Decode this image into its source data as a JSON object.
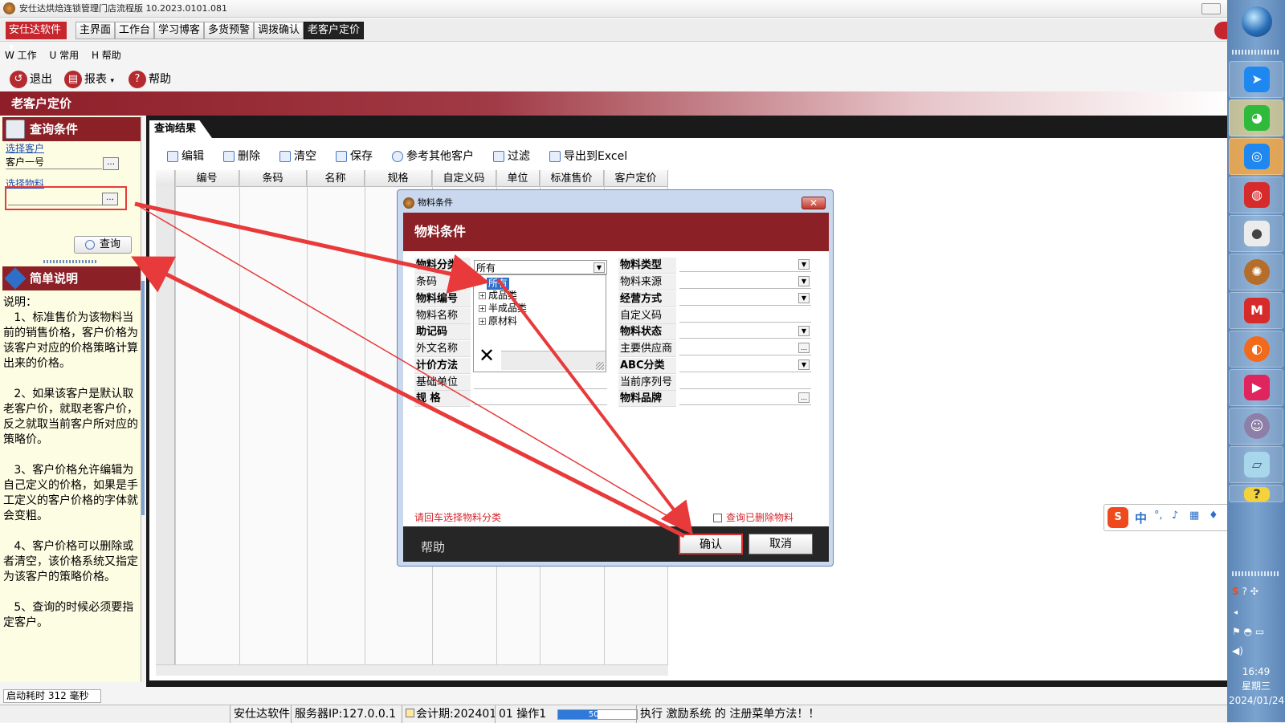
{
  "window": {
    "title": "安仕达烘焙连锁管理门店流程版  10.2023.0101.081"
  },
  "brand": {
    "label": "安仕达软件"
  },
  "main_tabs": [
    "主界面",
    "工作台",
    "学习博客",
    "多货预警",
    "调拨确认",
    "老客户定价"
  ],
  "menu": [
    "W 工作",
    "U 常用",
    "H 帮助"
  ],
  "toolbar": {
    "exit": "退出",
    "report": "报表",
    "help": "帮助"
  },
  "page_title": "老客户定价",
  "left": {
    "query_header": "查询条件",
    "select_customer": "选择客户",
    "customer_value": "客户一号",
    "select_material": "选择物料",
    "material_value": "",
    "query_button": "查询",
    "desc_header": "简单说明",
    "desc": "说明：\n   1、标准售价为该物料当前的销售价格，客户价格为该客户对应的价格策略计算出来的价格。\n\n   2、如果该客户是默认取老客户价，就取老客户价，反之就取当前客户所对应的策略价。\n\n   3、客户价格允许编辑为自己定义的价格，如果是手工定义的客户价格的字体就会变粗。\n\n   4、客户价格可以删除或者清空，该价格系统又指定为该客户的策略价格。\n\n   5、查询的时候必须要指定客户。",
    "startup": "启动耗时 312 毫秒"
  },
  "result": {
    "tab": "查询结果",
    "tools": [
      "编辑",
      "删除",
      "清空",
      "保存",
      "参考其他客户",
      "过滤",
      "导出到Excel"
    ],
    "columns": [
      "编号",
      "条码",
      "名称",
      "规格",
      "自定义码",
      "单位",
      "标准售价",
      "客户定价"
    ]
  },
  "dialog": {
    "title": "物料条件",
    "header": "物料条件",
    "left_labels": [
      "物料分类",
      "条码",
      "物料编号",
      "物料名称",
      "助记码",
      "外文名称",
      "计价方法",
      "基础单位",
      "规      格"
    ],
    "category_value": "所有",
    "tree": [
      "所有",
      "成品类",
      "半成品类",
      "原材料"
    ],
    "right_labels": [
      "物料类型",
      "物料来源",
      "经营方式",
      "自定义码",
      "物料状态",
      "主要供应商",
      "ABC分类",
      "当前序列号",
      "物料品牌"
    ],
    "hint": "请回车选择物料分类",
    "deleted_checkbox": "查询已删除物料",
    "help": "帮助",
    "ok": "确认",
    "cancel": "取消"
  },
  "statusbar": {
    "company": "安仕达软件",
    "server": "服务器IP:127.0.0.1",
    "period": "会计期:202401",
    "operator": "01 操作1",
    "progress_percent": 50,
    "progress_label": "50%",
    "message": "执行 激励系统 的 注册菜单方法！！"
  },
  "taskbar": {
    "time": "16:49",
    "weekday": "星期三",
    "date": "2024/01/24",
    "ime_label": "中"
  },
  "colors": {
    "brand_red": "#8b2026",
    "accent_red": "#c6262e",
    "annotation": "#e83a3a"
  }
}
